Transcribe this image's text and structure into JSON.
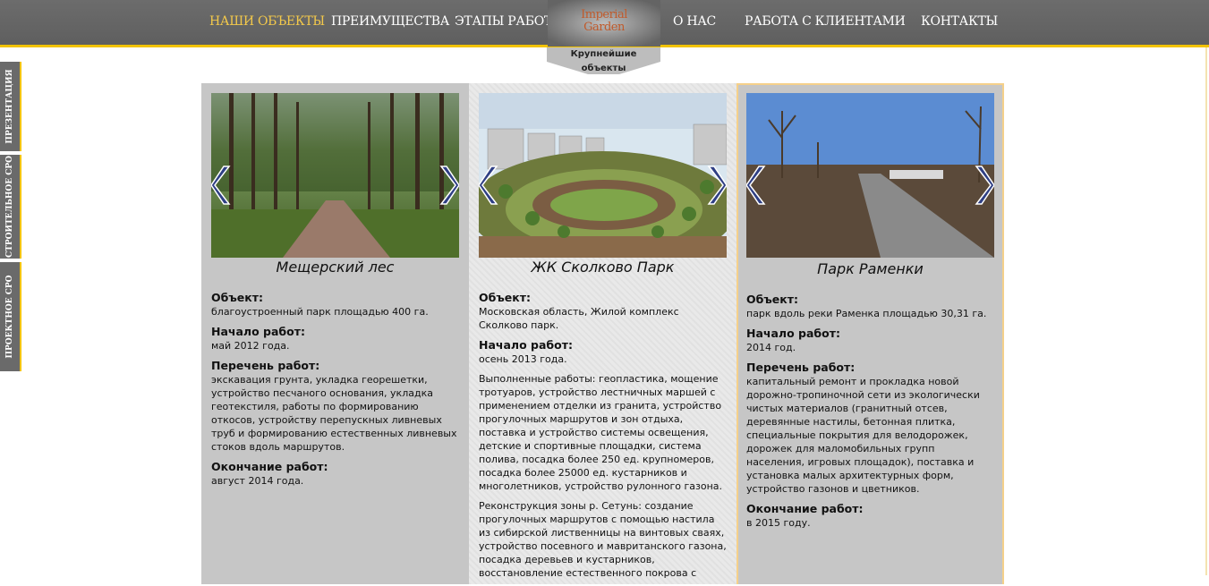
{
  "nav": {
    "items": [
      "НАШИ ОБЪЕКТЫ",
      "ПРЕИМУЩЕСТВА",
      "ЭТАПЫ РАБОТ",
      "О НАС",
      "РАБОТА С КЛИЕНТАМИ",
      "КОНТАКТЫ"
    ],
    "active_index": 0,
    "logo_line1": "Imperial",
    "logo_line2": "Garden",
    "subtab": "Крупнейшие объекты"
  },
  "side_tabs": [
    "ПРЕЗЕНТАЦИЯ",
    "СТРОИТЕЛЬНОЕ СРО",
    "ПРОЕКТНОЕ СРО"
  ],
  "colors": {
    "accent": "#f2c300",
    "nav_bg": "#606060",
    "active_nav": "#f2c84b",
    "card_bg": "#c6c6c6",
    "selected_border": "#f5d08a",
    "arrow": "#3a4a8a"
  },
  "icons": {
    "prev": "chevron-left-icon",
    "next": "chevron-right-icon"
  },
  "cards": [
    {
      "title": "Мещерский лес",
      "object_label": "Объект:",
      "object_text": "благоустроенный парк площадью 400 га.",
      "start_label": "Начало работ:",
      "start_text": "май 2012 года.",
      "works_label": "Перечень работ:",
      "works_text": "экскавация грунта, укладка георешетки, устройство песчаного основания, укладка геотекстиля, работы по формированию откосов, устройству перепускных ливневых труб и формированию естественных ливневых стоков вдоль маршрутов.",
      "end_label": "Окончание работ:",
      "end_text": "август 2014 года."
    },
    {
      "title": "ЖК Сколково Парк",
      "object_label": "Объект:",
      "object_text": "Московская область, Жилой комплекс Сколково парк.",
      "start_label": "Начало работ:",
      "start_text": "осень 2013 года.",
      "paragraph1": "Выполненные работы: геопластика, мощение тротуаров, устройство лестничных маршей с применением отделки из гранита, устройство прогулочных маршрутов и зон отдыха, поставка и устройство системы освещения, детские и спортивные площадки, система полива, посадка более 250 ед. крупномеров, посадка более 25000 ед. кустарников и многолетников, устройство рулонного газона.",
      "paragraph2": "Реконструкция зоны р. Сетунь: создание прогулочных маршрутов с помощью настила из сибирской лиственницы на винтовых сваях, устройство посевного и мавританского газона, посадка деревьев и кустарников, восстановление естественного покрова с"
    },
    {
      "title": "Парк Раменки",
      "object_label": "Объект:",
      "object_text": "парк вдоль реки Раменка площадью 30,31 га.",
      "start_label": "Начало работ:",
      "start_text": "2014 год.",
      "works_label": "Перечень работ:",
      "works_text": "капитальный ремонт и прокладка новой дорожно-тропиночной сети из экологически чистых материалов (гранитный отсев, деревянные настилы, бетонная плитка, специальные покрытия для велодорожек, дорожек для маломобильных групп населения, игровых площадок), поставка и установка малых архитектурных форм, устройство газонов и цветников.",
      "end_label": "Окончание работ:",
      "end_text": "в 2015 году."
    }
  ]
}
